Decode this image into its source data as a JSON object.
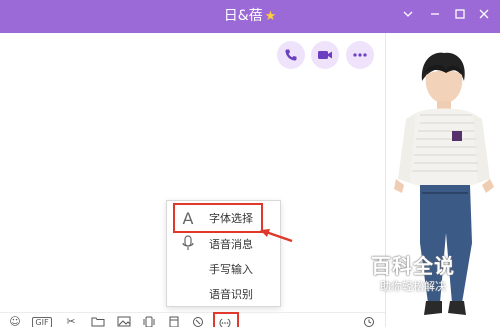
{
  "window": {
    "title": "日&蓓",
    "title_icon": "star-icon"
  },
  "window_controls": [
    "minimize",
    "restore",
    "close"
  ],
  "header_actions": [
    "phone-call",
    "video-call",
    "more-options"
  ],
  "menu": {
    "items": [
      {
        "label": "字体选择",
        "icon": "font-icon"
      },
      {
        "label": "语音消息",
        "icon": "microphone-icon"
      },
      {
        "label": "手写输入",
        "icon": ""
      },
      {
        "label": "语音识别",
        "icon": ""
      }
    ]
  },
  "toolbar": {
    "gif_label": "GIF",
    "icons": [
      "emoji-icon",
      "gif-icon",
      "scissors-icon",
      "folder-icon",
      "image-icon",
      "shake-icon",
      "red-packet-icon",
      "voice-icon",
      "more-icon",
      "history-icon"
    ]
  },
  "watermark": {
    "title": "百科全说",
    "subtitle": "助你轻松解决"
  },
  "colors": {
    "titlebar": "#9b6ad6",
    "accent": "#7b4fc9",
    "highlight": "#e0392b"
  }
}
